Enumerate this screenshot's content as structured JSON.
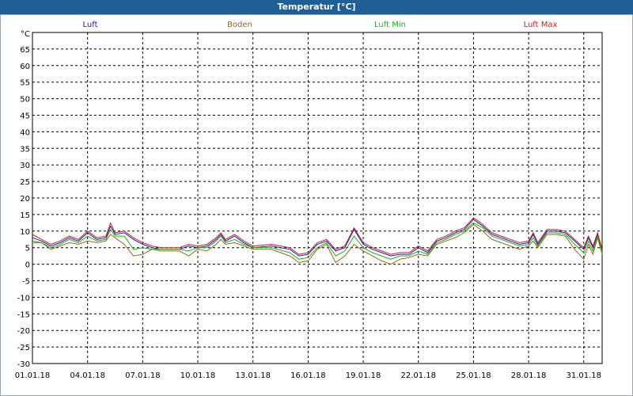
{
  "window": {
    "title": "Temperatur [°C]"
  },
  "chart_data": {
    "type": "line",
    "y_unit": "°C",
    "ylim": [
      -30,
      70
    ],
    "yticks": [
      65,
      60,
      55,
      50,
      45,
      40,
      35,
      30,
      25,
      20,
      15,
      10,
      5,
      0,
      -5,
      -10,
      -15,
      -20,
      -25,
      -30
    ],
    "xlim": [
      "01.01.18",
      "01.02.18"
    ],
    "xticks": [
      "01.01.18",
      "04.01.18",
      "07.01.18",
      "10.01.18",
      "13.01.18",
      "16.01.18",
      "19.01.18",
      "22.01.18",
      "25.01.18",
      "28.01.18",
      "31.01.18"
    ],
    "grid": true,
    "legend_position": "top",
    "series": [
      {
        "name": "Luft",
        "color": "#1a1ab4",
        "points": [
          [
            "01.01.18",
            8
          ],
          [
            "01.01.18 12:00",
            7
          ],
          [
            "02.01.18",
            5.5
          ],
          [
            "02.01.18 12:00",
            6.5
          ],
          [
            "03.01.18",
            8
          ],
          [
            "03.01.18 12:00",
            7
          ],
          [
            "04.01.18",
            9.5
          ],
          [
            "04.01.18 12:00",
            7.5
          ],
          [
            "05.01.18",
            8
          ],
          [
            "05.01.18 06:00",
            11.5
          ],
          [
            "05.01.18 12:00",
            9
          ],
          [
            "06.01.18",
            9.5
          ],
          [
            "06.01.18 12:00",
            7.5
          ],
          [
            "07.01.18",
            6
          ],
          [
            "07.01.18 12:00",
            5
          ],
          [
            "08.01.18",
            4.5
          ],
          [
            "09.01.18",
            4.5
          ],
          [
            "09.01.18 12:00",
            5.5
          ],
          [
            "10.01.18",
            5
          ],
          [
            "10.01.18 12:00",
            5.5
          ],
          [
            "11.01.18",
            7.5
          ],
          [
            "11.01.18 06:00",
            9
          ],
          [
            "11.01.18 12:00",
            7
          ],
          [
            "12.01.18",
            8.5
          ],
          [
            "12.01.18 12:00",
            6.5
          ],
          [
            "13.01.18",
            5
          ],
          [
            "14.01.18",
            5.5
          ],
          [
            "15.01.18",
            4.5
          ],
          [
            "15.01.18 12:00",
            2.5
          ],
          [
            "16.01.18",
            3
          ],
          [
            "16.01.18 12:00",
            6
          ],
          [
            "17.01.18",
            7
          ],
          [
            "17.01.18 12:00",
            4
          ],
          [
            "18.01.18",
            5
          ],
          [
            "18.01.18 12:00",
            10.5
          ],
          [
            "19.01.18",
            6
          ],
          [
            "19.01.18 12:00",
            4.5
          ],
          [
            "20.01.18",
            3.5
          ],
          [
            "20.01.18 12:00",
            2.5
          ],
          [
            "21.01.18",
            3
          ],
          [
            "21.01.18 12:00",
            3
          ],
          [
            "22.01.18",
            5
          ],
          [
            "22.01.18 12:00",
            3.5
          ],
          [
            "23.01.18",
            7
          ],
          [
            "23.01.18 12:00",
            8
          ],
          [
            "24.01.18",
            9.5
          ],
          [
            "24.01.18 12:00",
            10.5
          ],
          [
            "25.01.18",
            13.5
          ],
          [
            "25.01.18 12:00",
            11.5
          ],
          [
            "26.01.18",
            9
          ],
          [
            "26.01.18 12:00",
            8
          ],
          [
            "27.01.18",
            7
          ],
          [
            "27.01.18 12:00",
            6
          ],
          [
            "28.01.18",
            6.5
          ],
          [
            "28.01.18 06:00",
            9
          ],
          [
            "28.01.18 12:00",
            6
          ],
          [
            "29.01.18",
            10
          ],
          [
            "29.01.18 12:00",
            10
          ],
          [
            "30.01.18",
            9.5
          ],
          [
            "30.01.18 12:00",
            7
          ],
          [
            "31.01.18",
            4.5
          ],
          [
            "31.01.18 06:00",
            8
          ],
          [
            "31.01.18 12:00",
            5
          ],
          [
            "31.01.18 18:00",
            9
          ],
          [
            "01.02.18",
            4
          ]
        ]
      },
      {
        "name": "Boden",
        "color": "#9c6220",
        "points": [
          [
            "01.01.18",
            6.5
          ],
          [
            "01.01.18 12:00",
            6.5
          ],
          [
            "02.01.18",
            4.5
          ],
          [
            "02.01.18 12:00",
            5.5
          ],
          [
            "03.01.18",
            6.5
          ],
          [
            "03.01.18 12:00",
            6
          ],
          [
            "04.01.18",
            7
          ],
          [
            "04.01.18 12:00",
            6.5
          ],
          [
            "05.01.18",
            7
          ],
          [
            "05.01.18 06:00",
            9
          ],
          [
            "05.01.18 12:00",
            8
          ],
          [
            "06.01.18",
            6
          ],
          [
            "06.01.18 12:00",
            2.5
          ],
          [
            "07.01.18",
            3
          ],
          [
            "07.01.18 12:00",
            4.5
          ],
          [
            "08.01.18",
            4
          ],
          [
            "09.01.18",
            4
          ],
          [
            "09.01.18 12:00",
            2.5
          ],
          [
            "10.01.18",
            4.5
          ],
          [
            "10.01.18 12:00",
            4
          ],
          [
            "11.01.18",
            6
          ],
          [
            "11.01.18 06:00",
            7.5
          ],
          [
            "11.01.18 12:00",
            6
          ],
          [
            "12.01.18",
            6.5
          ],
          [
            "12.01.18 12:00",
            5.5
          ],
          [
            "13.01.18",
            4.5
          ],
          [
            "14.01.18",
            4.5
          ],
          [
            "15.01.18",
            2.5
          ],
          [
            "15.01.18 12:00",
            0.5
          ],
          [
            "16.01.18",
            1
          ],
          [
            "16.01.18 12:00",
            4.5
          ],
          [
            "17.01.18",
            6
          ],
          [
            "17.01.18 12:00",
            0.5
          ],
          [
            "18.01.18",
            2.5
          ],
          [
            "18.01.18 12:00",
            6
          ],
          [
            "19.01.18",
            4
          ],
          [
            "19.01.18 12:00",
            2.5
          ],
          [
            "20.01.18",
            1
          ],
          [
            "20.01.18 12:00",
            0
          ],
          [
            "21.01.18",
            1.5
          ],
          [
            "21.01.18 12:00",
            2
          ],
          [
            "22.01.18",
            3
          ],
          [
            "22.01.18 12:00",
            2.5
          ],
          [
            "23.01.18",
            6
          ],
          [
            "23.01.18 12:00",
            7
          ],
          [
            "24.01.18",
            8
          ],
          [
            "24.01.18 12:00",
            9.5
          ],
          [
            "25.01.18",
            12
          ],
          [
            "25.01.18 12:00",
            10
          ],
          [
            "26.01.18",
            7.5
          ],
          [
            "26.01.18 12:00",
            6.5
          ],
          [
            "27.01.18",
            5.5
          ],
          [
            "27.01.18 12:00",
            4.5
          ],
          [
            "28.01.18",
            5.5
          ],
          [
            "28.01.18 06:00",
            7
          ],
          [
            "28.01.18 12:00",
            5
          ],
          [
            "29.01.18",
            9
          ],
          [
            "29.01.18 12:00",
            9
          ],
          [
            "30.01.18",
            8.5
          ],
          [
            "30.01.18 12:00",
            4.5
          ],
          [
            "31.01.18",
            1.5
          ],
          [
            "31.01.18 06:00",
            6
          ],
          [
            "31.01.18 12:00",
            3
          ],
          [
            "31.01.18 18:00",
            8
          ],
          [
            "01.02.18",
            3
          ]
        ]
      },
      {
        "name": "Luft Min",
        "color": "#18b418",
        "points": [
          [
            "01.01.18",
            7
          ],
          [
            "01.01.18 12:00",
            6.5
          ],
          [
            "02.01.18",
            5
          ],
          [
            "02.01.18 12:00",
            6
          ],
          [
            "03.01.18",
            7.5
          ],
          [
            "03.01.18 12:00",
            6.5
          ],
          [
            "04.01.18",
            8.5
          ],
          [
            "04.01.18 12:00",
            7
          ],
          [
            "05.01.18",
            7.5
          ],
          [
            "05.01.18 06:00",
            10.5
          ],
          [
            "05.01.18 12:00",
            8.5
          ],
          [
            "06.01.18",
            8.5
          ],
          [
            "06.01.18 12:00",
            4.5
          ],
          [
            "07.01.18",
            5
          ],
          [
            "07.01.18 12:00",
            4.5
          ],
          [
            "08.01.18",
            4.5
          ],
          [
            "09.01.18",
            4.5
          ],
          [
            "09.01.18 12:00",
            4
          ],
          [
            "10.01.18",
            5
          ],
          [
            "10.01.18 12:00",
            5
          ],
          [
            "11.01.18",
            7
          ],
          [
            "11.01.18 06:00",
            8.5
          ],
          [
            "11.01.18 12:00",
            6.5
          ],
          [
            "12.01.18",
            7.5
          ],
          [
            "12.01.18 12:00",
            6
          ],
          [
            "13.01.18",
            5
          ],
          [
            "14.01.18",
            5
          ],
          [
            "15.01.18",
            3.5
          ],
          [
            "15.01.18 12:00",
            1.5
          ],
          [
            "16.01.18",
            2
          ],
          [
            "16.01.18 12:00",
            5
          ],
          [
            "17.01.18",
            6.5
          ],
          [
            "17.01.18 12:00",
            2.5
          ],
          [
            "18.01.18",
            4
          ],
          [
            "18.01.18 12:00",
            8.5
          ],
          [
            "19.01.18",
            5
          ],
          [
            "19.01.18 12:00",
            3.5
          ],
          [
            "20.01.18",
            2.5
          ],
          [
            "20.01.18 12:00",
            1.5
          ],
          [
            "21.01.18",
            2.5
          ],
          [
            "21.01.18 12:00",
            2.5
          ],
          [
            "22.01.18",
            4
          ],
          [
            "22.01.18 12:00",
            3
          ],
          [
            "23.01.18",
            6.5
          ],
          [
            "23.01.18 12:00",
            7.5
          ],
          [
            "24.01.18",
            9
          ],
          [
            "24.01.18 12:00",
            10
          ],
          [
            "25.01.18",
            12.5
          ],
          [
            "25.01.18 12:00",
            11
          ],
          [
            "26.01.18",
            8.5
          ],
          [
            "26.01.18 12:00",
            7.5
          ],
          [
            "27.01.18",
            6.5
          ],
          [
            "27.01.18 12:00",
            5.5
          ],
          [
            "28.01.18",
            6
          ],
          [
            "28.01.18 06:00",
            8
          ],
          [
            "28.01.18 12:00",
            5.5
          ],
          [
            "29.01.18",
            9.5
          ],
          [
            "29.01.18 12:00",
            9.5
          ],
          [
            "30.01.18",
            9
          ],
          [
            "30.01.18 12:00",
            6
          ],
          [
            "31.01.18",
            3.5
          ],
          [
            "31.01.18 06:00",
            7
          ],
          [
            "31.01.18 12:00",
            4
          ],
          [
            "31.01.18 18:00",
            8.5
          ],
          [
            "01.02.18",
            3.5
          ]
        ]
      },
      {
        "name": "Luft Max",
        "color": "#c81e1e",
        "points": [
          [
            "01.01.18",
            9
          ],
          [
            "01.01.18 12:00",
            7.5
          ],
          [
            "02.01.18",
            6
          ],
          [
            "02.01.18 12:00",
            7
          ],
          [
            "03.01.18",
            8.5
          ],
          [
            "03.01.18 12:00",
            7.5
          ],
          [
            "04.01.18",
            10
          ],
          [
            "04.01.18 12:00",
            8
          ],
          [
            "05.01.18",
            8.5
          ],
          [
            "05.01.18 06:00",
            12.5
          ],
          [
            "05.01.18 12:00",
            9.5
          ],
          [
            "06.01.18",
            10
          ],
          [
            "06.01.18 12:00",
            8
          ],
          [
            "07.01.18",
            6.5
          ],
          [
            "07.01.18 12:00",
            5.5
          ],
          [
            "08.01.18",
            5
          ],
          [
            "09.01.18",
            5
          ],
          [
            "09.01.18 12:00",
            6
          ],
          [
            "10.01.18",
            5.5
          ],
          [
            "10.01.18 12:00",
            6
          ],
          [
            "11.01.18",
            8
          ],
          [
            "11.01.18 06:00",
            9.5
          ],
          [
            "11.01.18 12:00",
            7.5
          ],
          [
            "12.01.18",
            9
          ],
          [
            "12.01.18 12:00",
            7
          ],
          [
            "13.01.18",
            5.5
          ],
          [
            "14.01.18",
            6
          ],
          [
            "15.01.18",
            5
          ],
          [
            "15.01.18 12:00",
            3
          ],
          [
            "16.01.18",
            3.5
          ],
          [
            "16.01.18 12:00",
            6.5
          ],
          [
            "17.01.18",
            7.5
          ],
          [
            "17.01.18 12:00",
            4.5
          ],
          [
            "18.01.18",
            5.5
          ],
          [
            "18.01.18 12:00",
            11
          ],
          [
            "19.01.18",
            6.5
          ],
          [
            "19.01.18 12:00",
            5
          ],
          [
            "20.01.18",
            4
          ],
          [
            "20.01.18 12:00",
            3
          ],
          [
            "21.01.18",
            3.5
          ],
          [
            "21.01.18 12:00",
            3.5
          ],
          [
            "22.01.18",
            5.5
          ],
          [
            "22.01.18 12:00",
            4
          ],
          [
            "23.01.18",
            7.5
          ],
          [
            "23.01.18 12:00",
            8.5
          ],
          [
            "24.01.18",
            10
          ],
          [
            "24.01.18 12:00",
            11
          ],
          [
            "25.01.18",
            14
          ],
          [
            "25.01.18 12:00",
            12
          ],
          [
            "26.01.18",
            9.5
          ],
          [
            "26.01.18 12:00",
            8.5
          ],
          [
            "27.01.18",
            7.5
          ],
          [
            "27.01.18 12:00",
            6.5
          ],
          [
            "28.01.18",
            7
          ],
          [
            "28.01.18 06:00",
            9.5
          ],
          [
            "28.01.18 12:00",
            6.5
          ],
          [
            "29.01.18",
            10.5
          ],
          [
            "29.01.18 12:00",
            10.5
          ],
          [
            "30.01.18",
            10
          ],
          [
            "30.01.18 12:00",
            7.5
          ],
          [
            "31.01.18",
            5
          ],
          [
            "31.01.18 06:00",
            8.5
          ],
          [
            "31.01.18 12:00",
            5.5
          ],
          [
            "31.01.18 18:00",
            9.5
          ],
          [
            "01.02.18",
            4.5
          ]
        ]
      }
    ]
  }
}
